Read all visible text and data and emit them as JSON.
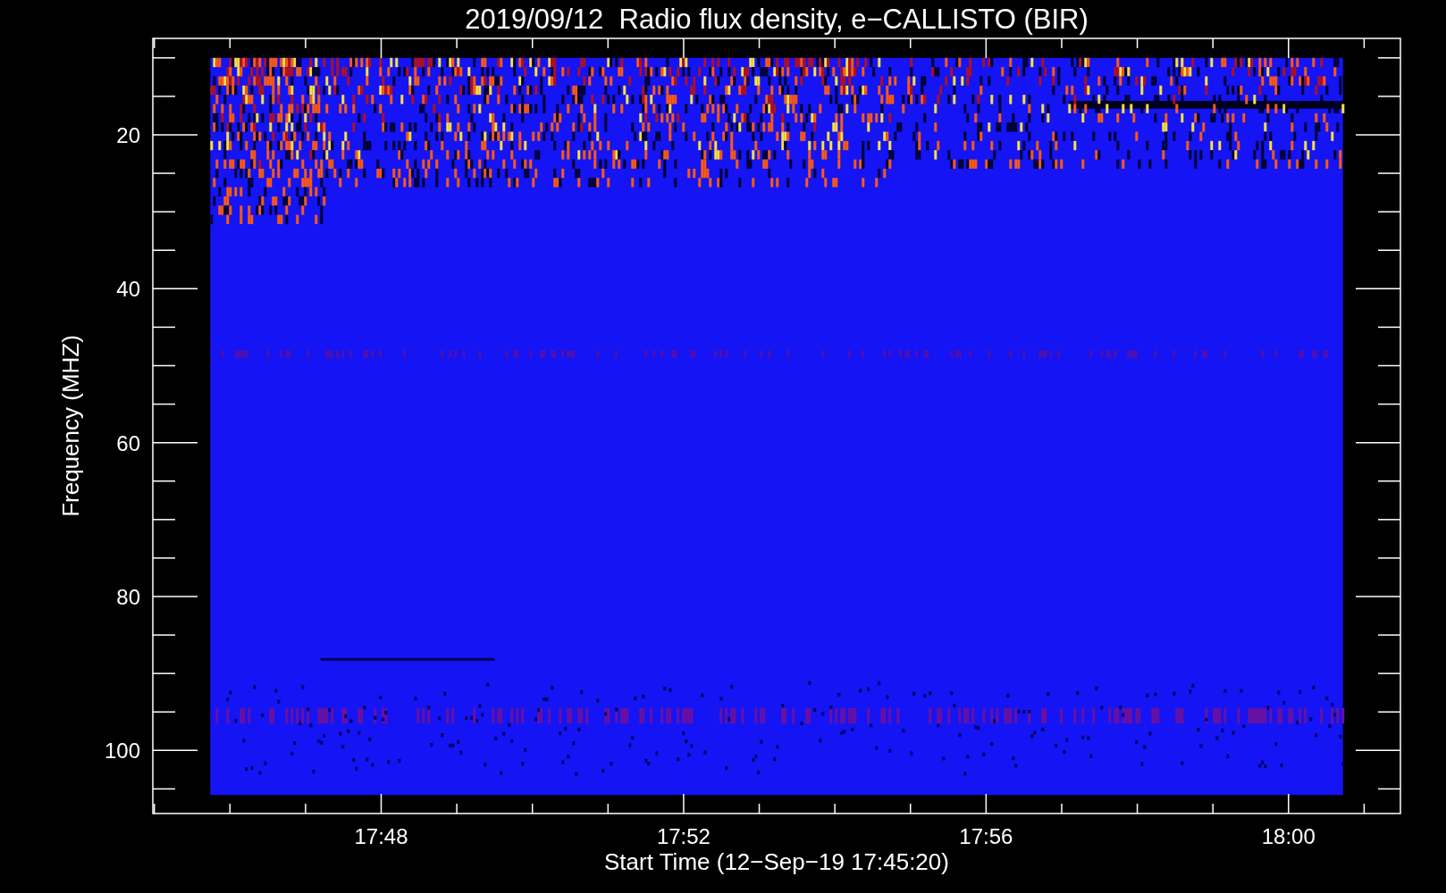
{
  "plot": {
    "title": "2019/09/12  Radio flux density, e−CALLISTO (BIR)",
    "xlabel": "Start Time (12−Sep−19 17:45:20)",
    "ylabel": "Frequency (MHZ)",
    "xticks": [
      "17:48",
      "17:52",
      "17:56",
      "18:00"
    ],
    "yticks": [
      "20",
      "40",
      "60",
      "80",
      "100"
    ]
  }
}
